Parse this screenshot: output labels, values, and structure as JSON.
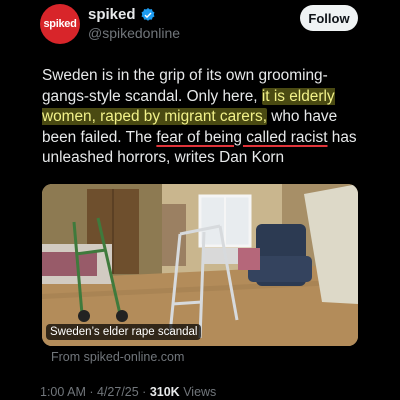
{
  "account": {
    "avatar_text": "spiked",
    "display_name": "spiked",
    "handle": "@spikedonline",
    "follow_label": "Follow"
  },
  "tweet": {
    "part1": "Sweden is in the grip of its own grooming-gangs-style scandal. Only here, ",
    "highlight": "it is elderly women, raped by migrant carers,",
    "part2": " who have been failed. The ",
    "underlined": "fear of being called racist",
    "part3": " has unleashed horrors, writes Dan Korn"
  },
  "card": {
    "caption": "Sweden’s elder rape scandal",
    "source": "From spiked-online.com"
  },
  "meta": {
    "time": "1:00 AM",
    "date": "4/27/25",
    "views_count": "310K",
    "views_label": "Views"
  },
  "colors": {
    "avatar": "#d8252a",
    "verified": "#1d9bf0",
    "highlight_bg": "#4a4a12",
    "underline": "#e0343a"
  }
}
